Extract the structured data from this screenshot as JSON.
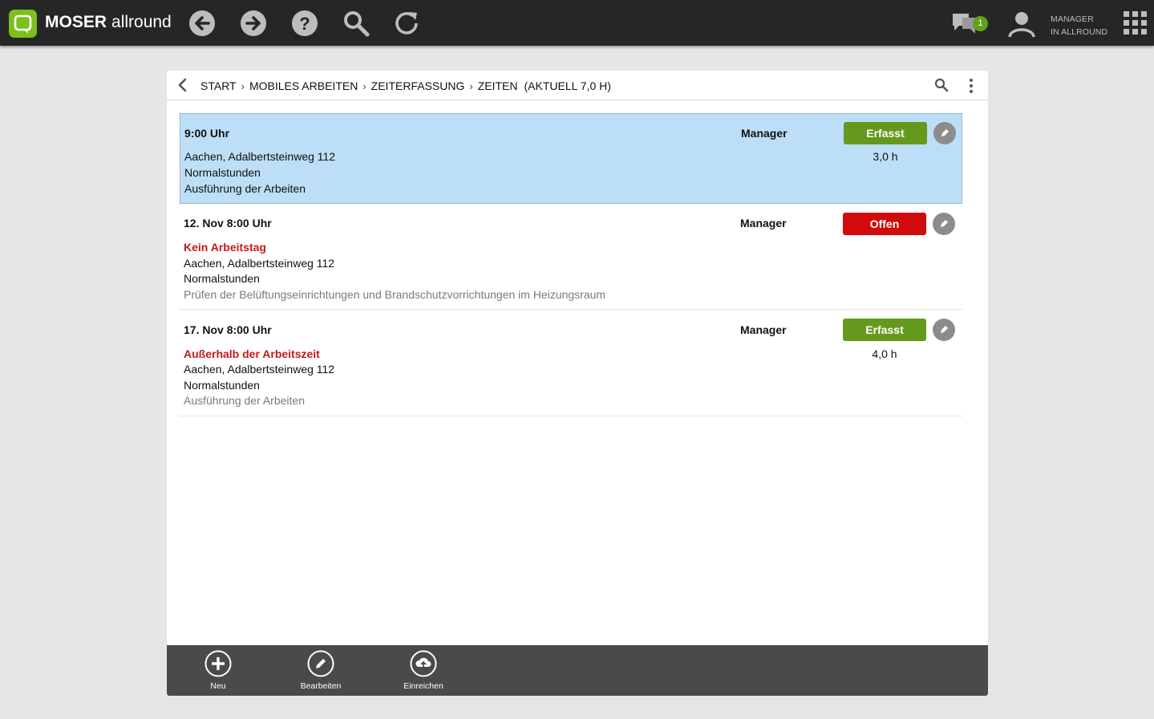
{
  "app": {
    "brand_bold": "MOSER",
    "brand_light": "allround",
    "accent": "#7dbf1f"
  },
  "topbar": {
    "icons": [
      "back-arrow-icon",
      "forward-arrow-icon",
      "help-icon",
      "search-icon",
      "refresh-icon"
    ],
    "messages_badge": "1",
    "user_line1": "MANAGER",
    "user_line2": "IN ALLROUND"
  },
  "breadcrumb": {
    "items": [
      "START",
      "MOBILES ARBEITEN",
      "ZEITERFASSUNG",
      "ZEITEN"
    ],
    "extra": "(AKTUELL 7,0 H)"
  },
  "entries": [
    {
      "when": "9:00 Uhr",
      "who": "Manager",
      "status": "Erfasst",
      "hours": "3,0 h",
      "warning": "",
      "location": "Aachen, Adalbertsteinweg 112",
      "type": "Normalstunden",
      "description": "Ausführung der Arbeiten"
    },
    {
      "when": "12. Nov 8:00 Uhr",
      "who": "Manager",
      "status": "Offen",
      "hours": "",
      "warning": "Kein Arbeitstag",
      "location": "Aachen, Adalbertsteinweg 112",
      "type": "Normalstunden",
      "description": "Prüfen der Belüftungseinrichtungen und Brandschutzvorrichtungen im Heizungsraum"
    },
    {
      "when": "17. Nov 8:00 Uhr",
      "who": "Manager",
      "status": "Erfasst",
      "hours": "4,0 h",
      "warning": "Außerhalb der Arbeitszeit",
      "location": "Aachen, Adalbertsteinweg 112",
      "type": "Normalstunden",
      "description": "Ausführung der Arbeiten"
    }
  ],
  "toolbar": {
    "new_label": "Neu",
    "edit_label": "Bearbeiten",
    "submit_label": "Einreichen"
  }
}
